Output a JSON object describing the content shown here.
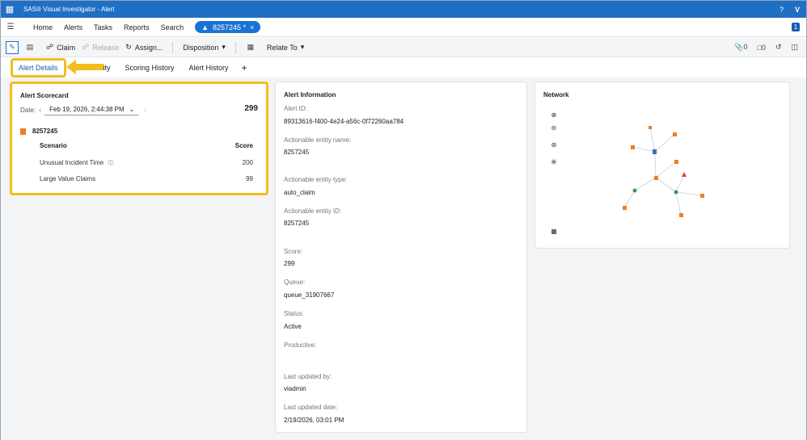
{
  "app": {
    "title": "SAS® Visual Investigator - Alert",
    "help": "?",
    "logo": "V",
    "notification_count": "1"
  },
  "nav": {
    "items": [
      "Home",
      "Alerts",
      "Tasks",
      "Reports",
      "Search"
    ],
    "open_alert_label": "8257245 *",
    "close_symbol": "×"
  },
  "toolbar": {
    "claim": "Claim",
    "release": "Release",
    "assign": "Assign...",
    "disposition": "Disposition",
    "relate_to": "Relate To",
    "attachments_count": "0",
    "comments_count": "0"
  },
  "tabs": {
    "alert_details": "Alert Details",
    "partial_tab": "ity",
    "scoring_history": "Scoring History",
    "alert_history": "Alert History",
    "add": "+"
  },
  "scorecard": {
    "title": "Alert Scorecard",
    "date_label": "Date:",
    "date_value": "Feb 19, 2026, 2:44:38 PM",
    "total_score": "299",
    "entity": "8257245",
    "col_scenario": "Scenario",
    "col_score": "Score",
    "rows": [
      {
        "scenario": "Unusual Incident Time",
        "score": "200"
      },
      {
        "scenario": "Large Value Claims",
        "score": "99"
      }
    ]
  },
  "alert_info": {
    "title": "Alert Information",
    "fields": [
      {
        "label": "Alert ID:",
        "value": "89313616-f400-4e24-a56c-0f72260aa784"
      },
      {
        "label": "Actionable entity name:",
        "value": "8257245"
      },
      {
        "label": "Actionable entity type:",
        "value": "auto_claim"
      },
      {
        "label": "Actionable entity ID:",
        "value": "8257245"
      },
      {
        "label": "Score:",
        "value": "299"
      },
      {
        "label": "Queue:",
        "value": "queue_31907667"
      },
      {
        "label": "Status:",
        "value": "Active"
      },
      {
        "label": "Productive:",
        "value": ""
      },
      {
        "label": "Last updated by:",
        "value": "viadmin"
      },
      {
        "label": "Last updated date:",
        "value": "2/19/2026, 03:01 PM"
      }
    ]
  },
  "network": {
    "title": "Network"
  },
  "colors": {
    "brand_blue": "#1f6fc5",
    "highlight": "#f2bd1d",
    "entity_orange": "#f07d22"
  }
}
